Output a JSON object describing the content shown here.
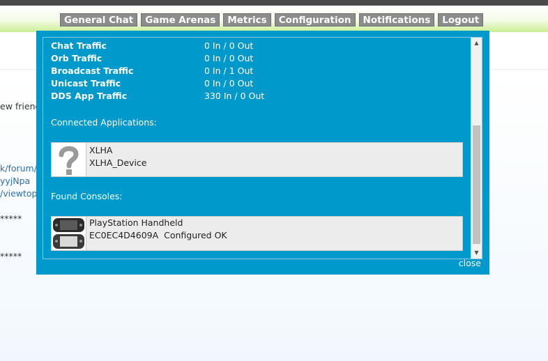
{
  "nav": {
    "tabs": [
      "General Chat",
      "Game Arenas",
      "Metrics",
      "Configuration",
      "Notifications",
      "Logout"
    ]
  },
  "background": {
    "lines": [
      "ew friend",
      "k/forum/",
      "yyjNpa",
      "/viewtop",
      "*****",
      "*****"
    ]
  },
  "traffic": [
    {
      "label": "Chat Traffic",
      "value": "0 In / 0 Out"
    },
    {
      "label": "Orb Traffic",
      "value": "0 In / 0 Out"
    },
    {
      "label": "Broadcast Traffic",
      "value": "0 In / 1 Out"
    },
    {
      "label": "Unicast Traffic",
      "value": "0 In / 0 Out"
    },
    {
      "label": "DDS App Traffic",
      "value": "330 In / 0 Out"
    }
  ],
  "connected_applications": {
    "title": "Connected Applications:",
    "items": [
      {
        "name": "XLHA",
        "detail": "XLHA_Device",
        "icon": "question-mark-icon"
      }
    ]
  },
  "found_consoles": {
    "title": "Found Consoles:",
    "items": [
      {
        "name": "PlayStation Handheld",
        "detail": "EC0EC4D4609A  Configured OK",
        "icon": "psp-console-icon"
      }
    ]
  },
  "modal": {
    "close_label": "close"
  },
  "colors": {
    "modal_bg": "#0099cc",
    "nav_tab_bg": "#8c8c8c"
  }
}
